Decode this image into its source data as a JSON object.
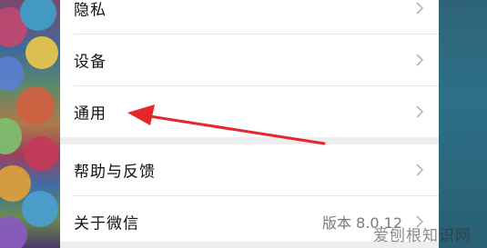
{
  "settings": {
    "items": [
      {
        "label": "隐私"
      },
      {
        "label": "设备"
      },
      {
        "label": "通用"
      },
      {
        "label": "帮助与反馈"
      },
      {
        "label": "关于微信",
        "value": "版本 8.0.12"
      }
    ]
  },
  "annotation": {
    "arrow_color": "#e5262a",
    "points_to": "通用"
  },
  "watermark": "爱刨根知识网"
}
